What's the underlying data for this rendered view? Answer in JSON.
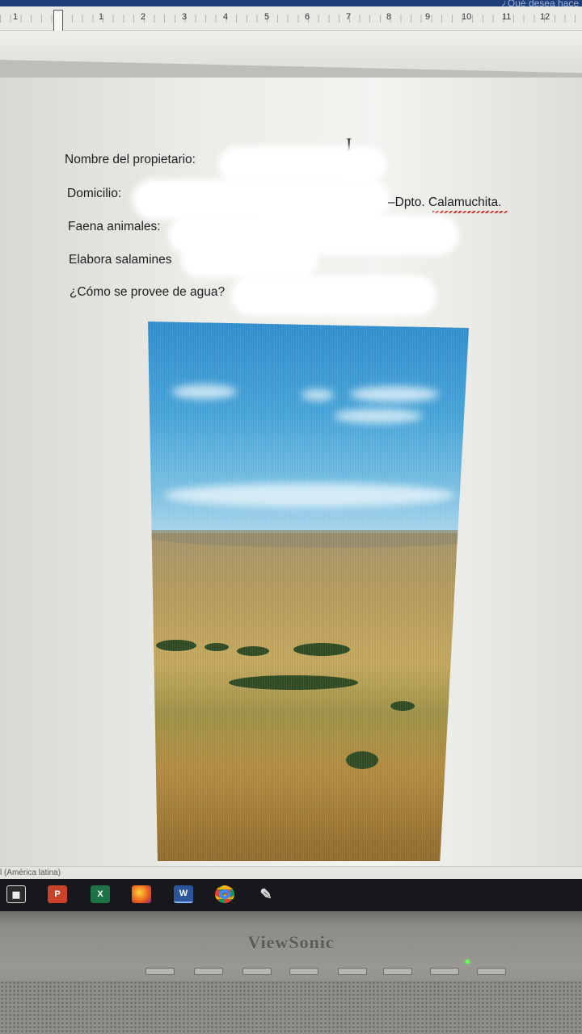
{
  "titlebar": {
    "search_hint": "¿Qué desea hace"
  },
  "ruler": {
    "numbers": [
      "1",
      "1",
      "2",
      "3",
      "4",
      "5",
      "6",
      "7",
      "8",
      "9",
      "10",
      "11",
      "12"
    ]
  },
  "document": {
    "fields": [
      {
        "label": "Nombre del propietario:"
      },
      {
        "label": "Domicilio:",
        "suffix": "–Dpto. Calamuchita."
      },
      {
        "label": "Faena animales:"
      },
      {
        "label": "Elabora salamines"
      },
      {
        "label": "¿Cómo se provee de agua?"
      }
    ]
  },
  "statusbar": {
    "language": "l (América latina)"
  },
  "taskbar": {
    "icons": [
      "windows-store-icon",
      "powerpoint-icon",
      "excel-icon",
      "firefox-icon",
      "word-icon",
      "chrome-icon",
      "paint-icon"
    ],
    "labels": {
      "powerpoint": "P",
      "excel": "X",
      "word": "W"
    }
  },
  "monitor": {
    "brand": "ViewSonic"
  }
}
